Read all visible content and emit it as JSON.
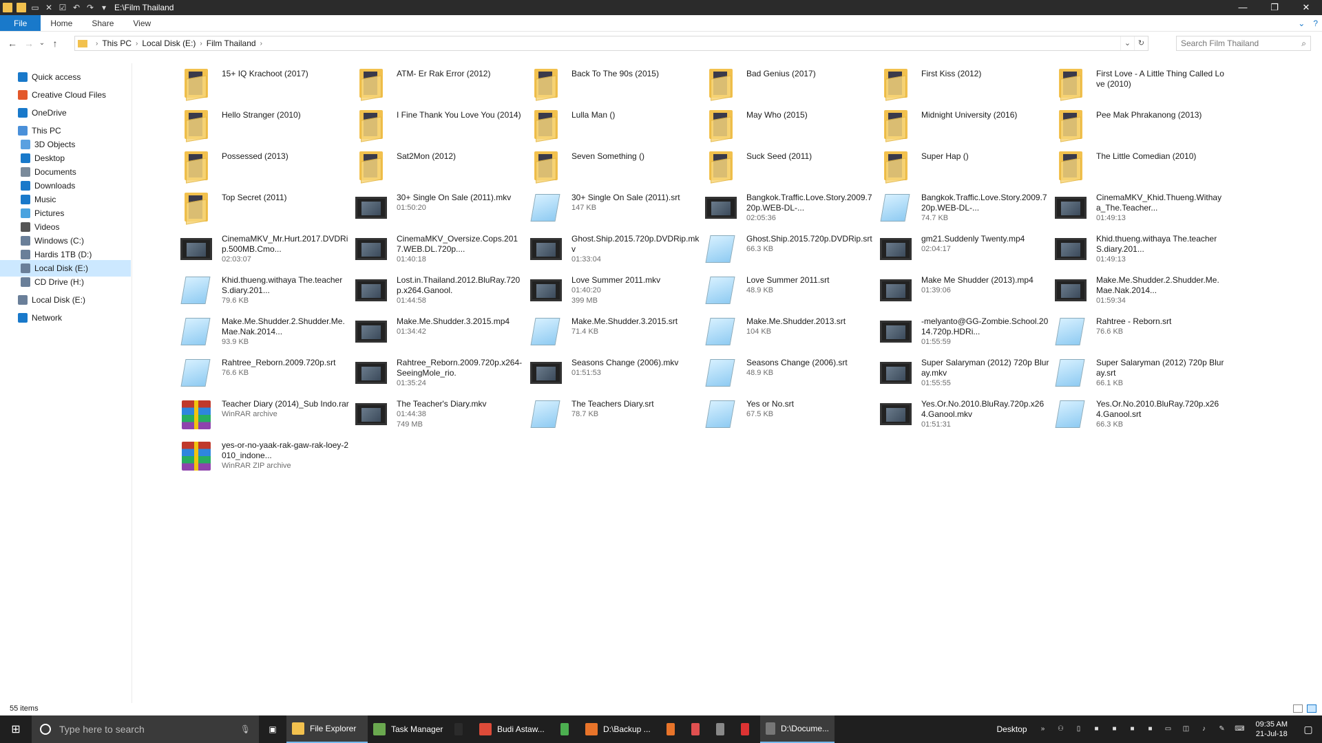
{
  "window": {
    "title": "E:\\Film Thailand",
    "controls": [
      "—",
      "❐",
      "✕"
    ]
  },
  "ribbon": {
    "tabs": [
      "File",
      "Home",
      "Share",
      "View"
    ]
  },
  "address": {
    "crumbs": [
      "This PC",
      "Local Disk (E:)",
      "Film Thailand"
    ]
  },
  "search": {
    "placeholder": "Search Film Thailand"
  },
  "nav": {
    "items": [
      {
        "label": "Quick access",
        "icon": "star-icon",
        "color": "#1979ca",
        "indent": 0
      },
      {
        "label": "Creative Cloud Files",
        "icon": "creative-cloud-icon",
        "color": "#e3582b",
        "indent": 0
      },
      {
        "label": "OneDrive",
        "icon": "cloud-icon",
        "color": "#1979ca",
        "indent": 0
      },
      {
        "label": "This PC",
        "icon": "computer-icon",
        "color": "#4a90d9",
        "indent": 0
      },
      {
        "label": "3D Objects",
        "icon": "cube-icon",
        "color": "#5aa0e0",
        "indent": 1
      },
      {
        "label": "Desktop",
        "icon": "desktop-icon",
        "color": "#1979ca",
        "indent": 1
      },
      {
        "label": "Documents",
        "icon": "document-icon",
        "color": "#7a8a9a",
        "indent": 1
      },
      {
        "label": "Downloads",
        "icon": "download-icon",
        "color": "#1979ca",
        "indent": 1
      },
      {
        "label": "Music",
        "icon": "music-icon",
        "color": "#1979ca",
        "indent": 1
      },
      {
        "label": "Pictures",
        "icon": "picture-icon",
        "color": "#4aa3df",
        "indent": 1
      },
      {
        "label": "Videos",
        "icon": "video-icon",
        "color": "#555555",
        "indent": 1
      },
      {
        "label": "Windows (C:)",
        "icon": "drive-icon",
        "color": "#6a7f99",
        "indent": 1
      },
      {
        "label": "Hardis 1TB (D:)",
        "icon": "drive-icon",
        "color": "#6a7f99",
        "indent": 1
      },
      {
        "label": "Local Disk (E:)",
        "icon": "drive-icon",
        "color": "#6a7f99",
        "indent": 1,
        "selected": true
      },
      {
        "label": "CD Drive (H:)",
        "icon": "cd-drive-icon",
        "color": "#6a7f99",
        "indent": 1
      },
      {
        "label": "Local Disk (E:)",
        "icon": "drive-icon",
        "color": "#6a7f99",
        "indent": 0
      },
      {
        "label": "Network",
        "icon": "network-icon",
        "color": "#1979ca",
        "indent": 0
      }
    ]
  },
  "files": [
    {
      "name": "15+ IQ Krachoot (2017)",
      "meta": [],
      "type": "folder"
    },
    {
      "name": "ATM- Er Rak Error (2012)",
      "meta": [],
      "type": "folder"
    },
    {
      "name": "Back To The 90s (2015)",
      "meta": [],
      "type": "folder"
    },
    {
      "name": "Bad Genius (2017)",
      "meta": [],
      "type": "folder"
    },
    {
      "name": "First Kiss (2012)",
      "meta": [],
      "type": "folder"
    },
    {
      "name": "First Love - A Little Thing Called Love (2010)",
      "meta": [],
      "type": "folder"
    },
    {
      "name": "Hello Stranger (2010)",
      "meta": [],
      "type": "folder"
    },
    {
      "name": "I Fine Thank You Love You (2014)",
      "meta": [],
      "type": "folder"
    },
    {
      "name": "Lulla Man ()",
      "meta": [],
      "type": "folder"
    },
    {
      "name": "May Who (2015)",
      "meta": [],
      "type": "folder"
    },
    {
      "name": "Midnight University (2016)",
      "meta": [],
      "type": "folder"
    },
    {
      "name": "Pee Mak Phrakanong (2013)",
      "meta": [],
      "type": "folder"
    },
    {
      "name": "Possessed (2013)",
      "meta": [],
      "type": "folder"
    },
    {
      "name": "Sat2Mon (2012)",
      "meta": [],
      "type": "folder"
    },
    {
      "name": "Seven Something ()",
      "meta": [],
      "type": "folder"
    },
    {
      "name": "Suck Seed (2011)",
      "meta": [],
      "type": "folder"
    },
    {
      "name": "Super Hap ()",
      "meta": [],
      "type": "folder"
    },
    {
      "name": "The Little Comedian (2010)",
      "meta": [],
      "type": "folder"
    },
    {
      "name": "Top Secret (2011)",
      "meta": [],
      "type": "folder"
    },
    {
      "name": "30+ Single On Sale (2011).mkv",
      "meta": [
        "01:50:20"
      ],
      "type": "video"
    },
    {
      "name": "30+ Single On Sale (2011).srt",
      "meta": [
        "147 KB"
      ],
      "type": "text"
    },
    {
      "name": "Bangkok.Traffic.Love.Story.2009.720p.WEB-DL-...",
      "meta": [
        "02:05:36"
      ],
      "type": "video"
    },
    {
      "name": "Bangkok.Traffic.Love.Story.2009.720p.WEB-DL-...",
      "meta": [
        "74.7 KB"
      ],
      "type": "text"
    },
    {
      "name": "CinemaMKV_Khid.Thueng.Withaya_The.Teacher...",
      "meta": [
        "01:49:13"
      ],
      "type": "video"
    },
    {
      "name": "CinemaMKV_Mr.Hurt.2017.DVDRip.500MB.Cmo...",
      "meta": [
        "02:03:07"
      ],
      "type": "video"
    },
    {
      "name": "CinemaMKV_Oversize.Cops.2017.WEB.DL.720p....",
      "meta": [
        "01:40:18"
      ],
      "type": "video"
    },
    {
      "name": "Ghost.Ship.2015.720p.DVDRip.mkv",
      "meta": [
        "01:33:04"
      ],
      "type": "video"
    },
    {
      "name": "Ghost.Ship.2015.720p.DVDRip.srt",
      "meta": [
        "66.3 KB"
      ],
      "type": "text"
    },
    {
      "name": "gm21.Suddenly Twenty.mp4",
      "meta": [
        "02:04:17"
      ],
      "type": "video"
    },
    {
      "name": "Khid.thueng.withaya The.teacher S.diary.201...",
      "meta": [
        "01:49:13"
      ],
      "type": "video"
    },
    {
      "name": "Khid.thueng.withaya The.teacher S.diary.201...",
      "meta": [
        "79.6 KB"
      ],
      "type": "text"
    },
    {
      "name": "Lost.in.Thailand.2012.BluRay.720p.x264.Ganool.",
      "meta": [
        "01:44:58"
      ],
      "type": "video"
    },
    {
      "name": "Love Summer 2011.mkv",
      "meta": [
        "01:40:20",
        "399 MB"
      ],
      "type": "video"
    },
    {
      "name": "Love Summer 2011.srt",
      "meta": [
        "48.9 KB"
      ],
      "type": "text"
    },
    {
      "name": "Make Me Shudder (2013).mp4",
      "meta": [
        "01:39:06"
      ],
      "type": "video"
    },
    {
      "name": "Make.Me.Shudder.2.Shudder.Me.Mae.Nak.2014...",
      "meta": [
        "01:59:34"
      ],
      "type": "video"
    },
    {
      "name": "Make.Me.Shudder.2.Shudder.Me.Mae.Nak.2014...",
      "meta": [
        "93.9 KB"
      ],
      "type": "text"
    },
    {
      "name": "Make.Me.Shudder.3.2015.mp4",
      "meta": [
        "01:34:42"
      ],
      "type": "video"
    },
    {
      "name": "Make.Me.Shudder.3.2015.srt",
      "meta": [
        "71.4 KB"
      ],
      "type": "text"
    },
    {
      "name": "Make.Me.Shudder.2013.srt",
      "meta": [
        "104 KB"
      ],
      "type": "text"
    },
    {
      "name": "-melyanto@GG-Zombie.School.2014.720p.HDRi...",
      "meta": [
        "01:55:59"
      ],
      "type": "video"
    },
    {
      "name": "Rahtree - Reborn.srt",
      "meta": [
        "76.6 KB"
      ],
      "type": "text"
    },
    {
      "name": "Rahtree_Reborn.2009.720p.srt",
      "meta": [
        "76.6 KB"
      ],
      "type": "text"
    },
    {
      "name": "Rahtree_Reborn.2009.720p.x264-SeeingMole_rio.",
      "meta": [
        "01:35:24"
      ],
      "type": "video"
    },
    {
      "name": "Seasons Change (2006).mkv",
      "meta": [
        "01:51:53"
      ],
      "type": "video"
    },
    {
      "name": "Seasons Change (2006).srt",
      "meta": [
        "48.9 KB"
      ],
      "type": "text"
    },
    {
      "name": "Super Salaryman (2012) 720p Bluray.mkv",
      "meta": [
        "01:55:55"
      ],
      "type": "video"
    },
    {
      "name": "Super Salaryman (2012) 720p Bluray.srt",
      "meta": [
        "66.1 KB"
      ],
      "type": "text"
    },
    {
      "name": "Teacher Diary (2014)_Sub Indo.rar",
      "meta": [
        "WinRAR archive"
      ],
      "type": "rar"
    },
    {
      "name": "The Teacher's Diary.mkv",
      "meta": [
        "01:44:38",
        "749 MB"
      ],
      "type": "video"
    },
    {
      "name": "The Teachers Diary.srt",
      "meta": [
        "78.7 KB"
      ],
      "type": "text"
    },
    {
      "name": "Yes or No.srt",
      "meta": [
        "67.5 KB"
      ],
      "type": "text"
    },
    {
      "name": "Yes.Or.No.2010.BluRay.720p.x264.Ganool.mkv",
      "meta": [
        "01:51:31"
      ],
      "type": "video"
    },
    {
      "name": "Yes.Or.No.2010.BluRay.720p.x264.Ganool.srt",
      "meta": [
        "66.3 KB"
      ],
      "type": "text"
    },
    {
      "name": "yes-or-no-yaak-rak-gaw-rak-loey-2010_indone...",
      "meta": [
        "WinRAR ZIP archive"
      ],
      "type": "rar"
    }
  ],
  "status": {
    "count": "55 items"
  },
  "taskbar": {
    "search_placeholder": "Type here to search",
    "apps": [
      {
        "label": "File Explorer",
        "color": "#f2c14e",
        "active": true
      },
      {
        "label": "Task Manager",
        "color": "#6aa84f",
        "active": false
      },
      {
        "label": "",
        "color": "#2b2b2b",
        "active": false
      },
      {
        "label": "Budi Astaw...",
        "color": "#dd4b39",
        "active": false
      },
      {
        "label": "",
        "color": "#4caf50",
        "active": false
      },
      {
        "label": "D:\\Backup ...",
        "color": "#e8742a",
        "active": false
      },
      {
        "label": "",
        "color": "#e8742a",
        "active": false
      },
      {
        "label": "",
        "color": "#e05050",
        "active": false
      },
      {
        "label": "",
        "color": "#888888",
        "active": false
      },
      {
        "label": "",
        "color": "#d33",
        "active": false
      },
      {
        "label": "D:\\Docume...",
        "color": "#777",
        "active": true
      }
    ],
    "desktop_label": "Desktop",
    "time": "09:35 AM",
    "date": "21-Jul-18"
  }
}
